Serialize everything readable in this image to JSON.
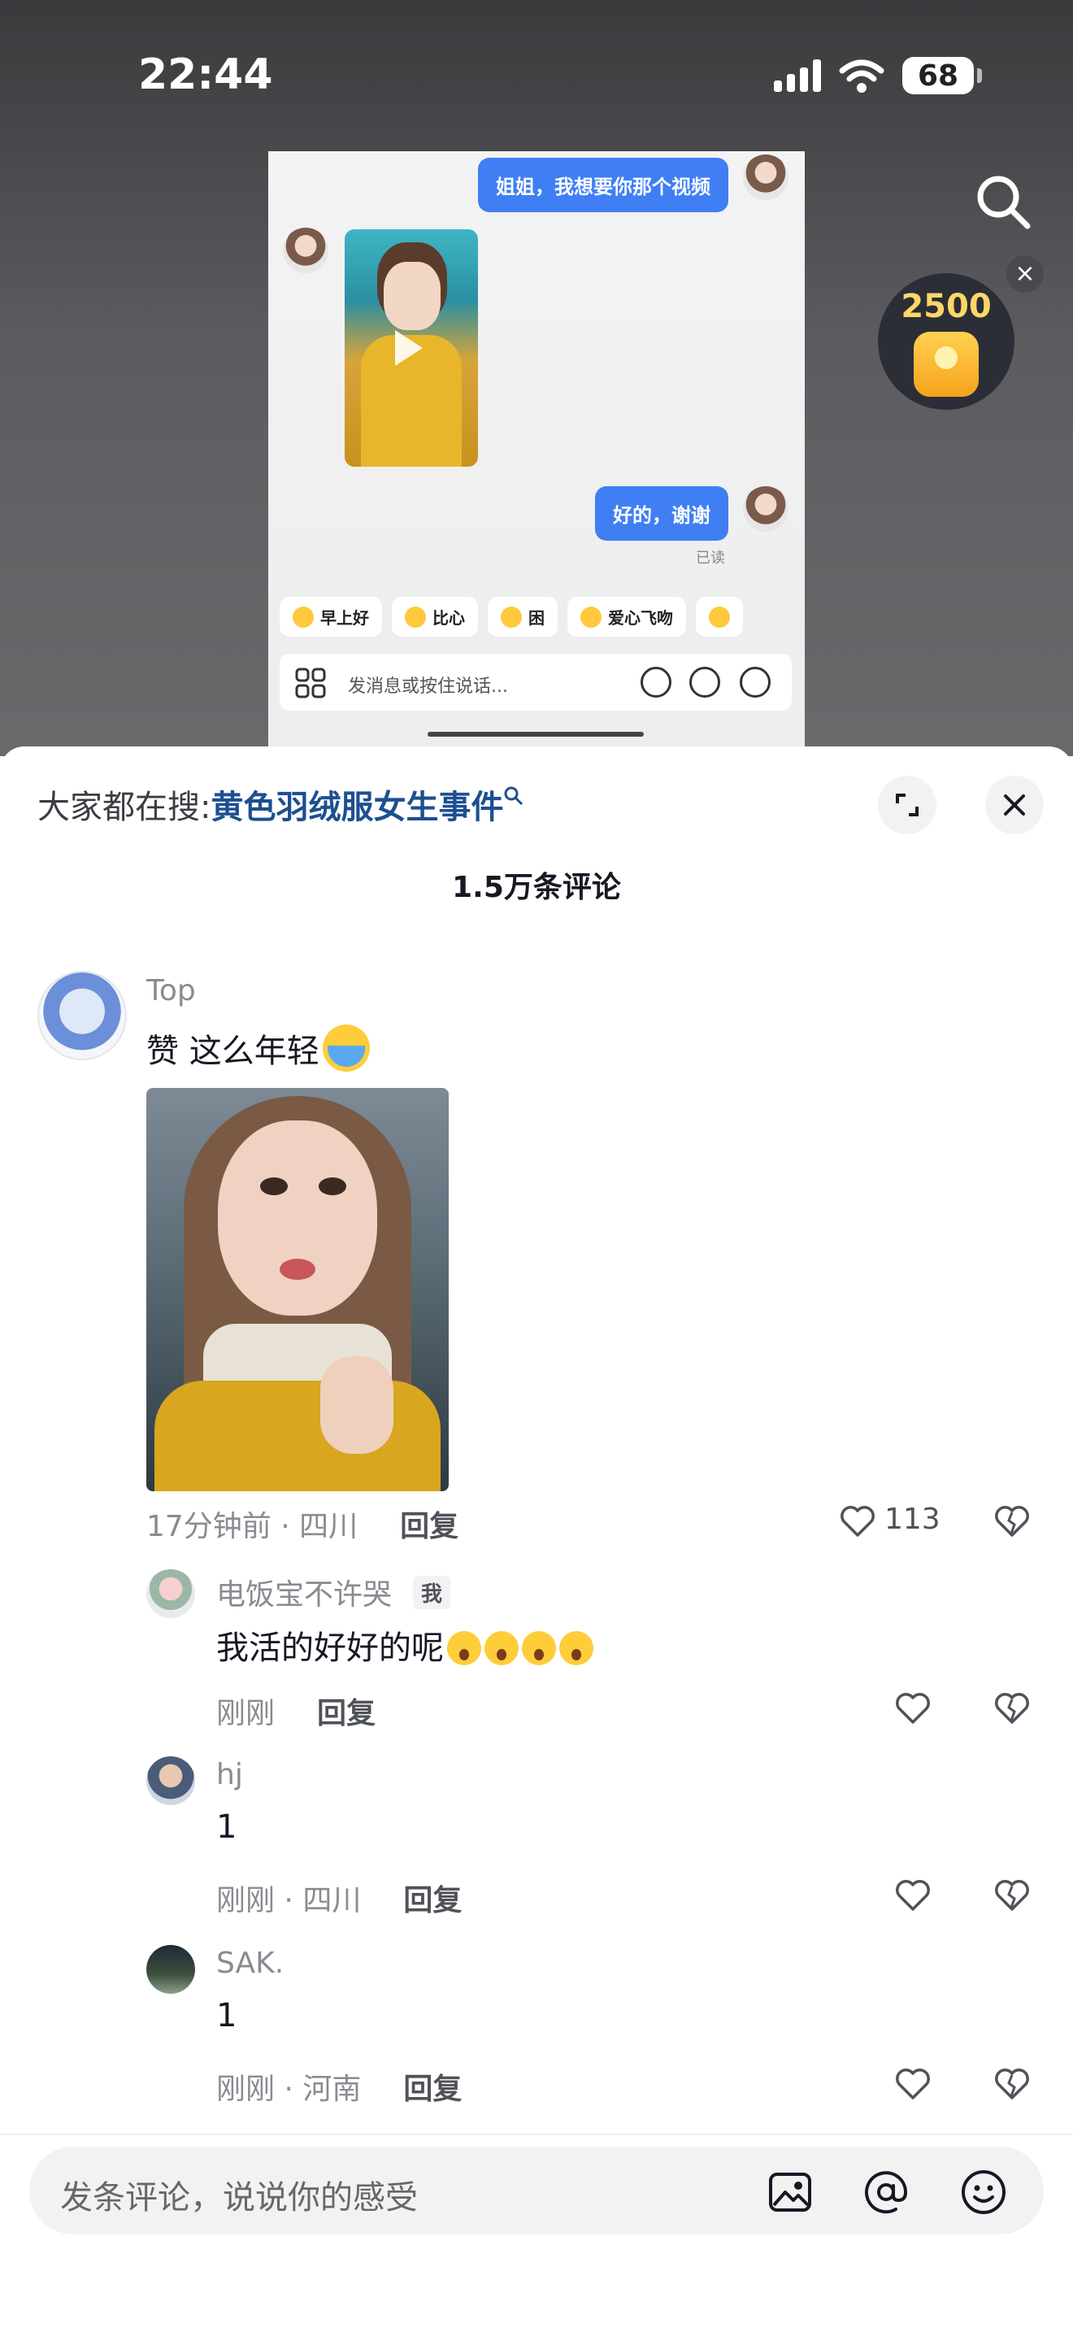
{
  "status_bar": {
    "time": "22:44",
    "battery": "68"
  },
  "reward_widget": {
    "coins": "2500"
  },
  "chat_screenshot": {
    "message_1": "姐姐，我想要你那个视频",
    "message_2": "好的，谢谢",
    "read_status": "已读",
    "quick_replies": [
      "早上好",
      "比心",
      "困",
      "爱心飞吻"
    ],
    "input_placeholder": "发消息或按住说话..."
  },
  "sheet": {
    "trending_prefix": "大家都在搜:",
    "trending_topic": "黄色羽绒服女生事件",
    "comment_count_title": "1.5万条评论"
  },
  "comments": [
    {
      "name": "Top",
      "text": "赞 这么年轻",
      "meta": "17分钟前 · 四川",
      "reply_label": "回复",
      "likes": "113"
    },
    {
      "name": "电饭宝不许哭",
      "badge": "我",
      "text": "我活的好好的呢",
      "meta": "刚刚",
      "reply_label": "回复"
    },
    {
      "name": "hj",
      "text": "1",
      "meta": "刚刚 · 四川",
      "reply_label": "回复"
    },
    {
      "name": "SAK.",
      "text": "1",
      "meta": "刚刚 · 河南",
      "reply_label": "回复"
    }
  ],
  "comment_input": {
    "placeholder": "发条评论，说说你的感受"
  },
  "colors": {
    "accent_blue": "#3f7ff3",
    "topic_blue": "#1d4f91",
    "meta_gray": "#8a8b91"
  }
}
